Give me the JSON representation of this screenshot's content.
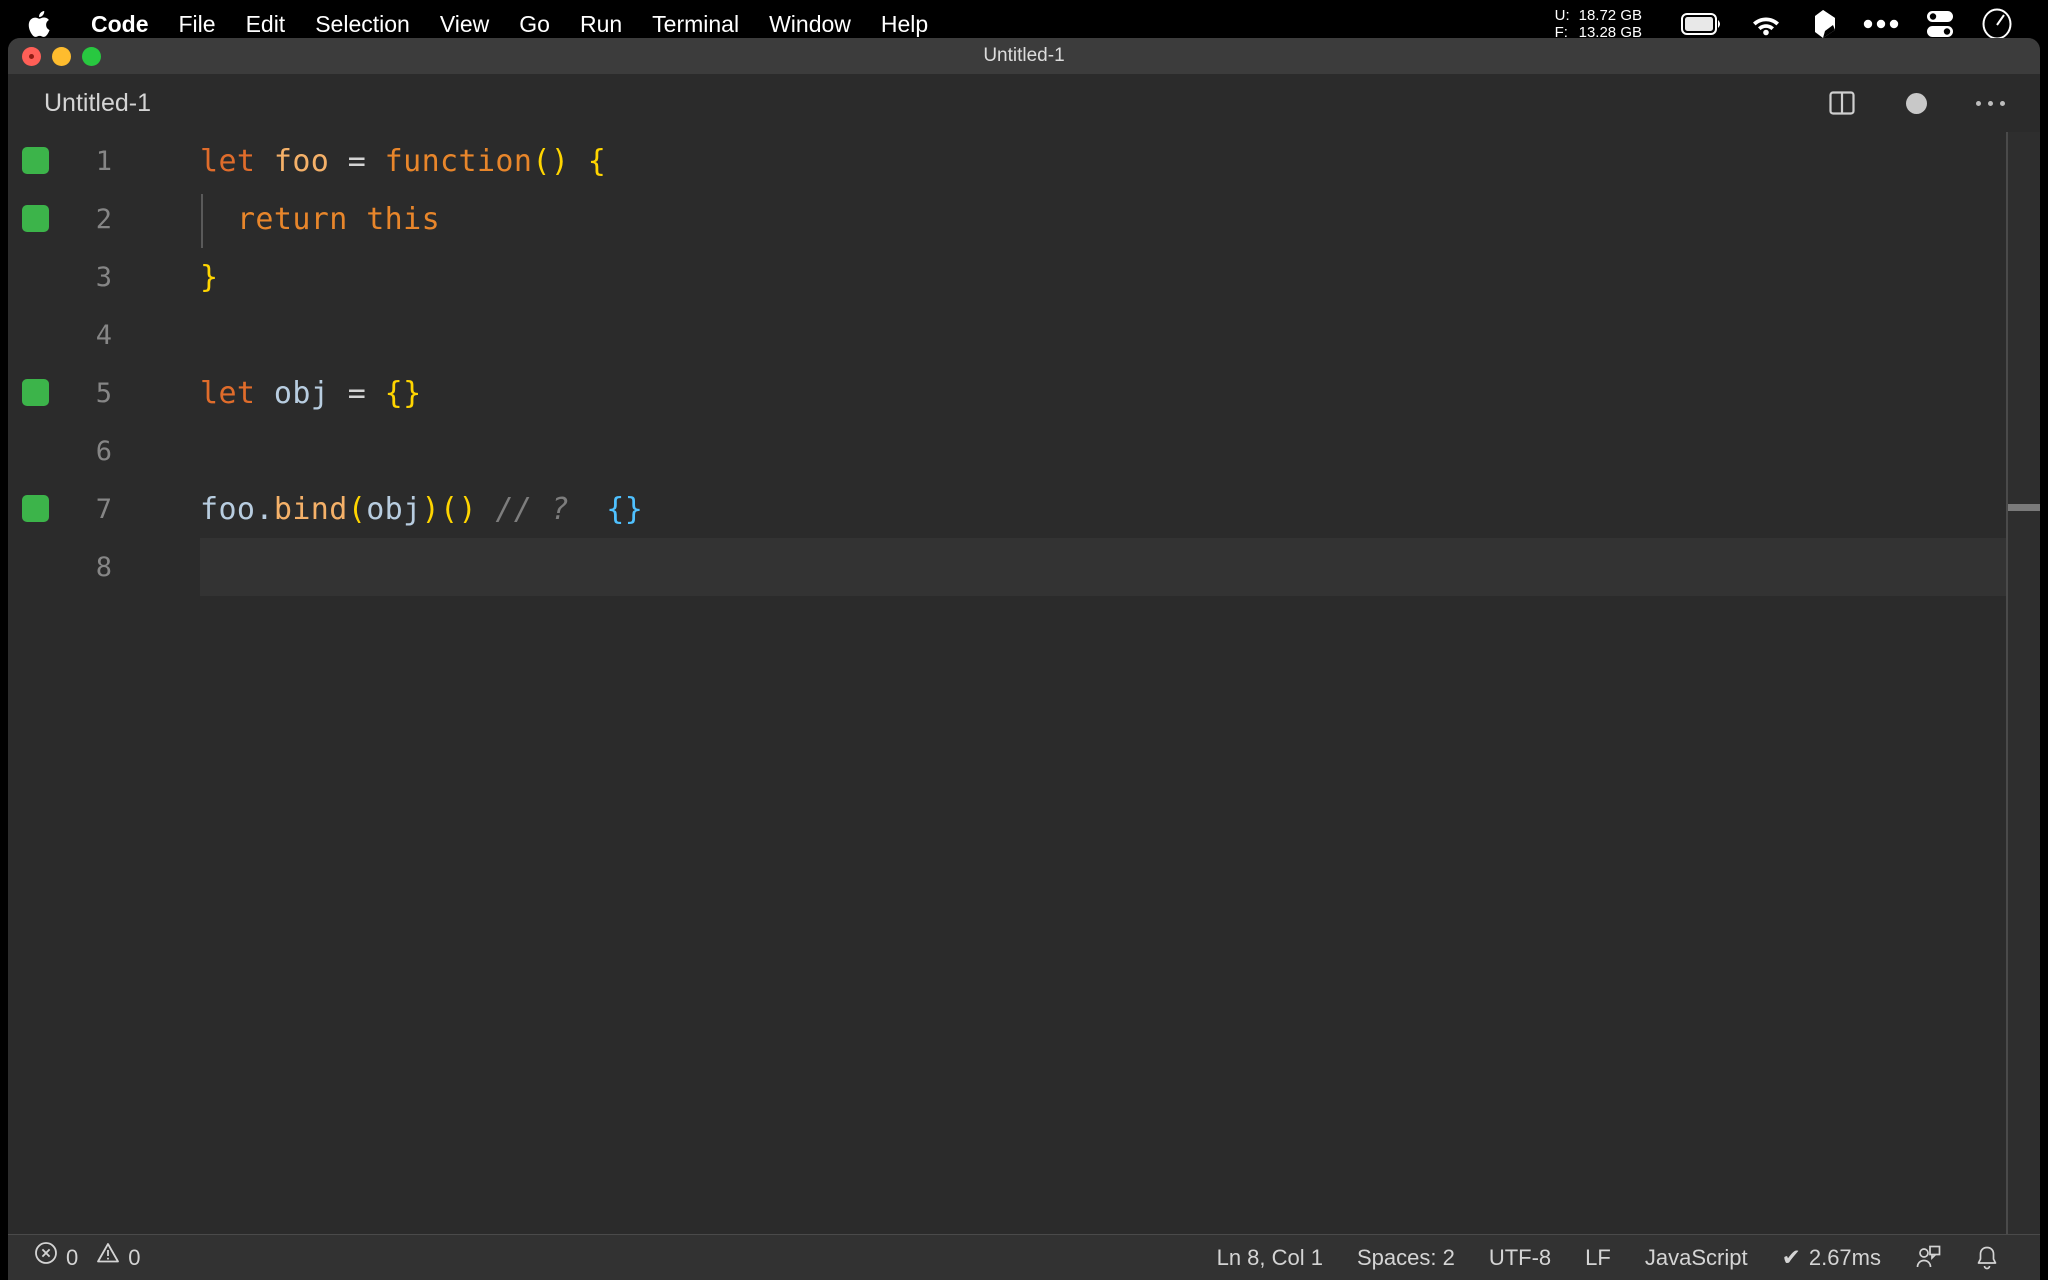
{
  "menubar": {
    "apple_icon": "apple-logo-icon",
    "items": [
      {
        "label": "Code",
        "bold": true
      },
      {
        "label": "File",
        "bold": false
      },
      {
        "label": "Edit",
        "bold": false
      },
      {
        "label": "Selection",
        "bold": false
      },
      {
        "label": "View",
        "bold": false
      },
      {
        "label": "Go",
        "bold": false
      },
      {
        "label": "Run",
        "bold": false
      },
      {
        "label": "Terminal",
        "bold": false
      },
      {
        "label": "Window",
        "bold": false
      },
      {
        "label": "Help",
        "bold": false
      }
    ],
    "memory": {
      "used_label": "U:",
      "used_value": "18.72 GB",
      "free_label": "F:",
      "free_value": "13.28 GB"
    },
    "icons": [
      "battery-icon",
      "wifi-icon",
      "dropbox-icon",
      "ellipsis-icon",
      "control-center-icon",
      "siri-clock-icon"
    ]
  },
  "window": {
    "title": "Untitled-1",
    "traffic_lights": [
      "close-button",
      "minimize-button",
      "maximize-button"
    ]
  },
  "editor_header": {
    "tab_label": "Untitled-1",
    "actions": [
      "split-editor-icon",
      "unsaved-indicator",
      "more-actions-icon"
    ]
  },
  "editor": {
    "language": "JavaScript",
    "lines": [
      {
        "number": "1",
        "marked": true,
        "indent_guide": false,
        "active": false,
        "tokens": [
          {
            "text": "let",
            "cls": "t-kw"
          },
          {
            "text": " ",
            "cls": "t-op"
          },
          {
            "text": "foo",
            "cls": "t-var"
          },
          {
            "text": " ",
            "cls": "t-op"
          },
          {
            "text": "=",
            "cls": "t-op"
          },
          {
            "text": " ",
            "cls": "t-op"
          },
          {
            "text": "function",
            "cls": "t-fn"
          },
          {
            "text": "()",
            "cls": "t-paren"
          },
          {
            "text": " ",
            "cls": "t-op"
          },
          {
            "text": "{",
            "cls": "t-paren"
          }
        ]
      },
      {
        "number": "2",
        "marked": true,
        "indent_guide": true,
        "active": false,
        "tokens": [
          {
            "text": "  ",
            "cls": "t-op"
          },
          {
            "text": "return",
            "cls": "t-fn"
          },
          {
            "text": " ",
            "cls": "t-op"
          },
          {
            "text": "this",
            "cls": "t-fn"
          }
        ]
      },
      {
        "number": "3",
        "marked": false,
        "indent_guide": false,
        "active": false,
        "tokens": [
          {
            "text": "}",
            "cls": "t-paren"
          }
        ]
      },
      {
        "number": "4",
        "marked": false,
        "indent_guide": false,
        "active": false,
        "tokens": []
      },
      {
        "number": "5",
        "marked": true,
        "indent_guide": false,
        "active": false,
        "tokens": [
          {
            "text": "let",
            "cls": "t-kw"
          },
          {
            "text": " ",
            "cls": "t-op"
          },
          {
            "text": "obj",
            "cls": "t-ident"
          },
          {
            "text": " ",
            "cls": "t-op"
          },
          {
            "text": "=",
            "cls": "t-op"
          },
          {
            "text": " ",
            "cls": "t-op"
          },
          {
            "text": "{}",
            "cls": "t-paren"
          }
        ]
      },
      {
        "number": "6",
        "marked": false,
        "indent_guide": false,
        "active": false,
        "tokens": []
      },
      {
        "number": "7",
        "marked": true,
        "indent_guide": false,
        "active": false,
        "tokens": [
          {
            "text": "foo",
            "cls": "t-ident"
          },
          {
            "text": ".",
            "cls": "t-punct"
          },
          {
            "text": "bind",
            "cls": "t-method"
          },
          {
            "text": "(",
            "cls": "t-paren"
          },
          {
            "text": "obj",
            "cls": "t-ident"
          },
          {
            "text": ")",
            "cls": "t-paren"
          },
          {
            "text": "()",
            "cls": "t-paren"
          },
          {
            "text": " ",
            "cls": "t-op"
          },
          {
            "text": "// ?",
            "cls": "t-comment"
          },
          {
            "text": "  ",
            "cls": "t-op"
          },
          {
            "text": "{}",
            "cls": "t-brace-b"
          }
        ]
      },
      {
        "number": "8",
        "marked": false,
        "indent_guide": false,
        "active": true,
        "tokens": []
      }
    ]
  },
  "statusbar": {
    "error_icon": "error-circle-icon",
    "error_count": "0",
    "warning_icon": "warning-triangle-icon",
    "warning_count": "0",
    "cursor_position": "Ln 8, Col 1",
    "indentation": "Spaces: 2",
    "encoding": "UTF-8",
    "eol": "LF",
    "language_mode": "JavaScript",
    "run_time": "2.67ms",
    "run_check_icon": "checkmark-icon",
    "feedback_icon": "feedback-person-icon",
    "bell_icon": "notifications-bell-icon"
  },
  "colors": {
    "menubar_bg": "#000000",
    "titlebar_bg": "#3c3c3c",
    "editor_bg": "#2b2b2b",
    "statusbar_bg": "#323232",
    "gutter_mark_green": "#3cb44a",
    "keyword_orange": "#e06c2b",
    "paren_yellow": "#ffd500",
    "identifier_blue": "#b8cde0",
    "brace_bright_blue": "#4fc1ff",
    "comment_gray": "#7d7d7d"
  }
}
